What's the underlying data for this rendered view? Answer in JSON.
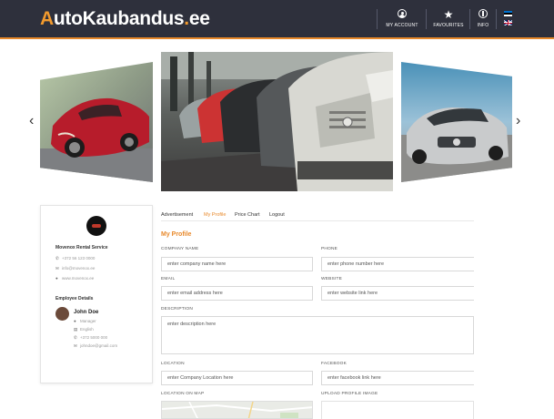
{
  "brand": {
    "logo_first": "A",
    "logo_main": "utoKaubandus",
    "logo_dot": ".",
    "logo_tld": "ee",
    "accent": "#e8892b",
    "header_bg": "#2e303c"
  },
  "nav": {
    "account_label": "MY ACCOUNT",
    "favourites_label": "FAVOURITES",
    "info_label": "INFO",
    "account_icon": "user-circle-icon",
    "favourites_icon": "star-icon",
    "info_icon": "info-icon",
    "languages": [
      "estonian-flag",
      "uk-flag"
    ]
  },
  "carousel": {
    "prev": "‹",
    "next": "›"
  },
  "profile_card": {
    "company": "Movenox Rental Service",
    "phone": "+372 56 123 0000",
    "email": "info@movenox.ee",
    "website": "www.movenox.ee",
    "section_title": "Employee Details",
    "employee": {
      "name": "John Doe",
      "role": "Manager",
      "language": "English",
      "phone": "+372 5000 000",
      "email": "johndoe@gmail.com"
    }
  },
  "tabs": [
    {
      "label": "Advertisement",
      "active": false
    },
    {
      "label": "My Profile",
      "active": true
    },
    {
      "label": "Price Chart",
      "active": false
    },
    {
      "label": "Logout",
      "active": false
    }
  ],
  "form": {
    "title": "My Profile",
    "company_name": {
      "label": "COMPANY NAME",
      "placeholder": "enter company name here"
    },
    "phone": {
      "label": "PHONE",
      "placeholder": "enter phone number here"
    },
    "email": {
      "label": "EMAIL",
      "placeholder": "enter email address here"
    },
    "website": {
      "label": "WEBSITE",
      "placeholder": "enter website link here"
    },
    "description": {
      "label": "DESCRIPTION",
      "placeholder": "enter description here"
    },
    "location": {
      "label": "LOCATION",
      "placeholder": "enter Company Location here"
    },
    "facebook": {
      "label": "FACEBOOK",
      "placeholder": "enter facebook link here"
    },
    "location_on_map": {
      "label": "LOCATION ON MAP"
    },
    "upload_profile_image": {
      "label": "UPLOAD PROFILE IMAGE"
    }
  }
}
